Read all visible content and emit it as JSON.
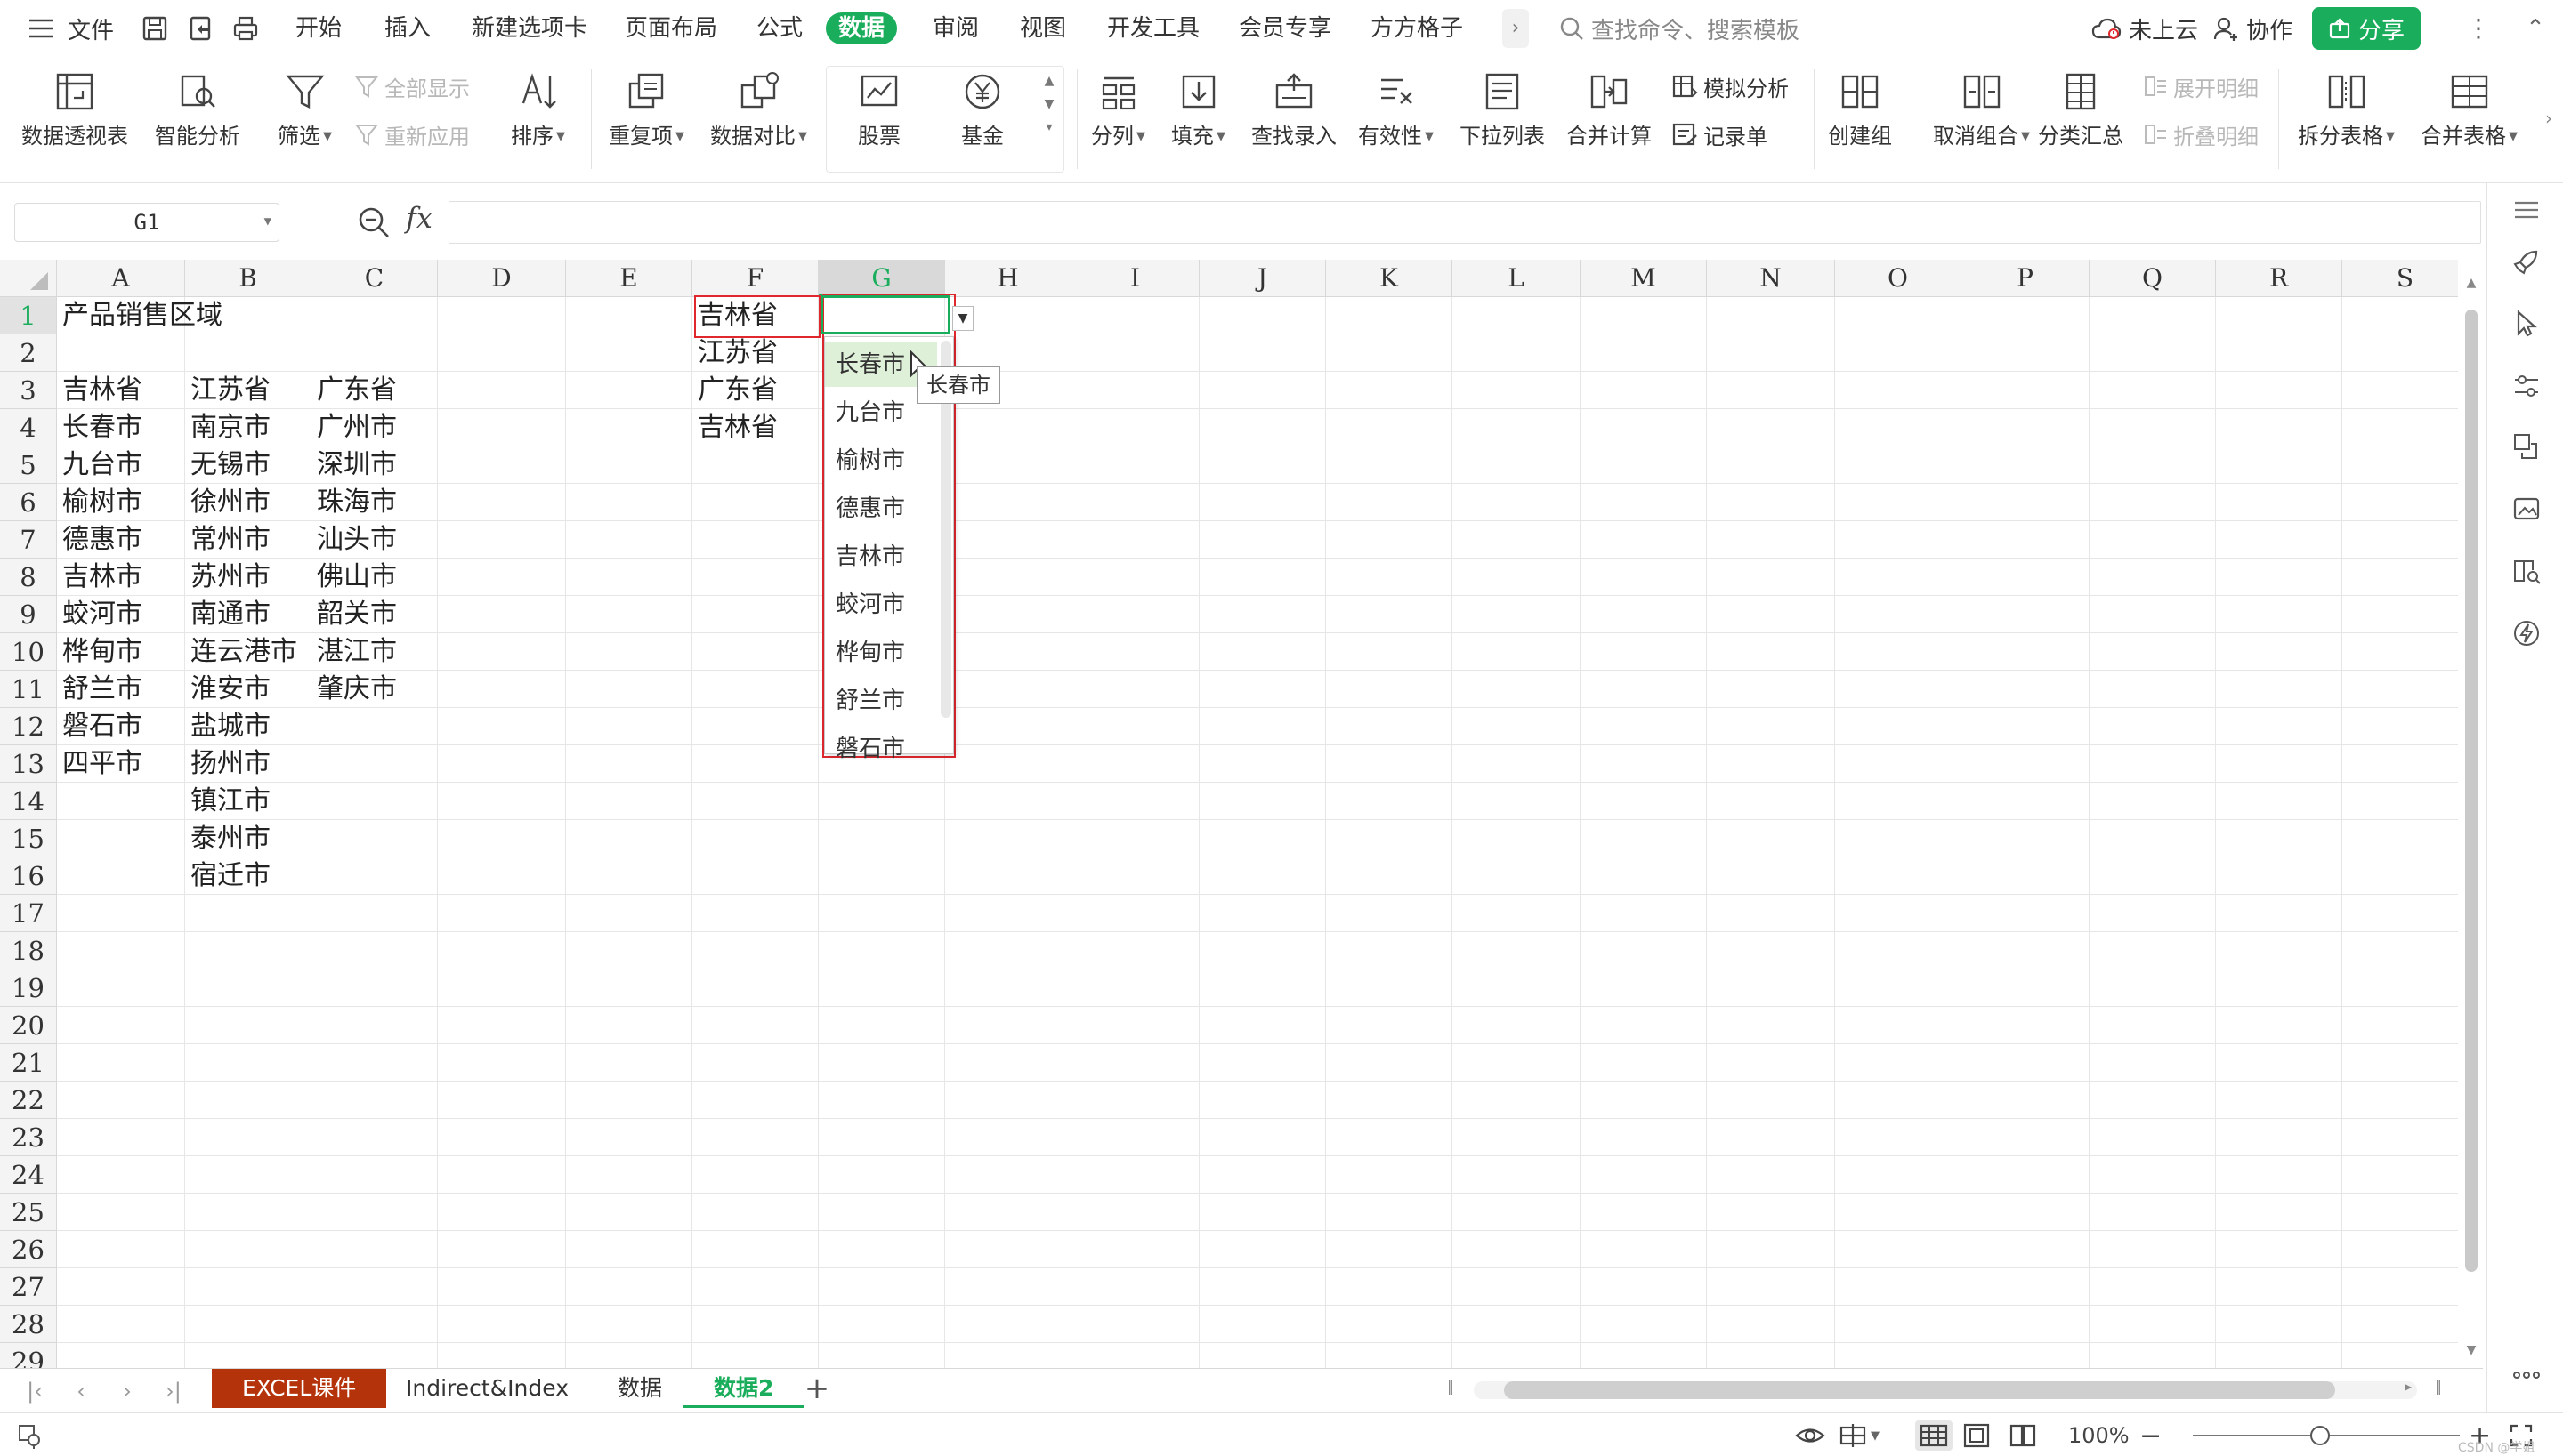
{
  "menubar": {
    "file_label": "文件",
    "tabs": [
      {
        "label": "开始",
        "active": false
      },
      {
        "label": "插入",
        "active": false
      },
      {
        "label": "新建选项卡",
        "active": false
      },
      {
        "label": "页面布局",
        "active": false
      },
      {
        "label": "公式",
        "active": false
      },
      {
        "label": "数据",
        "active": true
      },
      {
        "label": "审阅",
        "active": false
      },
      {
        "label": "视图",
        "active": false
      },
      {
        "label": "开发工具",
        "active": false
      },
      {
        "label": "会员专享",
        "active": false
      },
      {
        "label": "方方格子",
        "active": false
      }
    ],
    "more_label": "›",
    "search_placeholder": "查找命令、搜索模板",
    "cloud_label": "未上云",
    "collab_label": "协作",
    "share_label": "分享",
    "dots": "⋮",
    "min": "⌃"
  },
  "ribbon": {
    "pivot": "数据透视表",
    "smart": "智能分析",
    "filter": "筛选",
    "show_all": "全部显示",
    "reapply": "重新应用",
    "sort": "排序",
    "dup": "重复项",
    "compare": "数据对比",
    "stock": "股票",
    "fund": "基金",
    "split": "分列",
    "fill": "填充",
    "lookup": "查找录入",
    "validity": "有效性",
    "dropdown": "下拉列表",
    "consolidate": "合并计算",
    "whatif": "模拟分析",
    "record": "记录单",
    "group": "创建组",
    "ungroup": "取消组合",
    "subtotal": "分类汇总",
    "expand": "展开明细",
    "collapse": "折叠明细",
    "split_table": "拆分表格",
    "merge_table": "合并表格"
  },
  "formula_bar": {
    "name_box": "G1",
    "fx": "fx",
    "formula": ""
  },
  "grid": {
    "columns": [
      "A",
      "B",
      "C",
      "D",
      "E",
      "F",
      "G",
      "H",
      "I",
      "J",
      "K",
      "L",
      "M",
      "N",
      "O",
      "P",
      "Q",
      "R",
      "S"
    ],
    "rows": [
      "1",
      "2",
      "3",
      "4",
      "5",
      "6",
      "7",
      "8",
      "9",
      "10",
      "11",
      "12",
      "13",
      "14",
      "15",
      "16",
      "17",
      "18",
      "19",
      "20",
      "21",
      "22",
      "23",
      "24",
      "25",
      "26",
      "27",
      "28",
      "29"
    ],
    "selected_col": "G",
    "selected_row": "1",
    "cells": {
      "A1": "产品销售区域",
      "A3": "吉林省",
      "B3": "江苏省",
      "C3": "广东省",
      "A4": "长春市",
      "B4": "南京市",
      "C4": "广州市",
      "A5": "九台市",
      "B5": "无锡市",
      "C5": "深圳市",
      "A6": "榆树市",
      "B6": "徐州市",
      "C6": "珠海市",
      "A7": "德惠市",
      "B7": "常州市",
      "C7": "汕头市",
      "A8": "吉林市",
      "B8": "苏州市",
      "C8": "佛山市",
      "A9": "蛟河市",
      "B9": "南通市",
      "C9": "韶关市",
      "A10": "桦甸市",
      "B10": "连云港市",
      "C10": "湛江市",
      "A11": "舒兰市",
      "B11": "淮安市",
      "C11": "肇庆市",
      "A12": "磐石市",
      "B12": "盐城市",
      "A13": "四平市",
      "B13": "扬州市",
      "B14": "镇江市",
      "B15": "泰州市",
      "B16": "宿迁市",
      "F1": "吉林省",
      "F2": "江苏省",
      "F3": "广东省",
      "F4": "吉林省"
    }
  },
  "dropdown_list": {
    "items": [
      "长春市",
      "九台市",
      "榆树市",
      "德惠市",
      "吉林市",
      "蛟河市",
      "桦甸市",
      "舒兰市",
      "磐石市"
    ],
    "hover_index": 0,
    "tooltip": "长春市"
  },
  "sheet_tabs": [
    {
      "label": "EXCEL课件",
      "style": "orange"
    },
    {
      "label": "Indirect&Index",
      "style": "normal"
    },
    {
      "label": "数据",
      "style": "normal"
    },
    {
      "label": "数据2",
      "style": "active"
    }
  ],
  "statusbar": {
    "zoom": "100%",
    "watermark": "CSDN @学姐"
  },
  "colors": {
    "accent_green": "#1aad5b",
    "highlight_red": "#e0272e",
    "orange_tab": "#b5330a",
    "hover_green": "#dff0d8"
  }
}
